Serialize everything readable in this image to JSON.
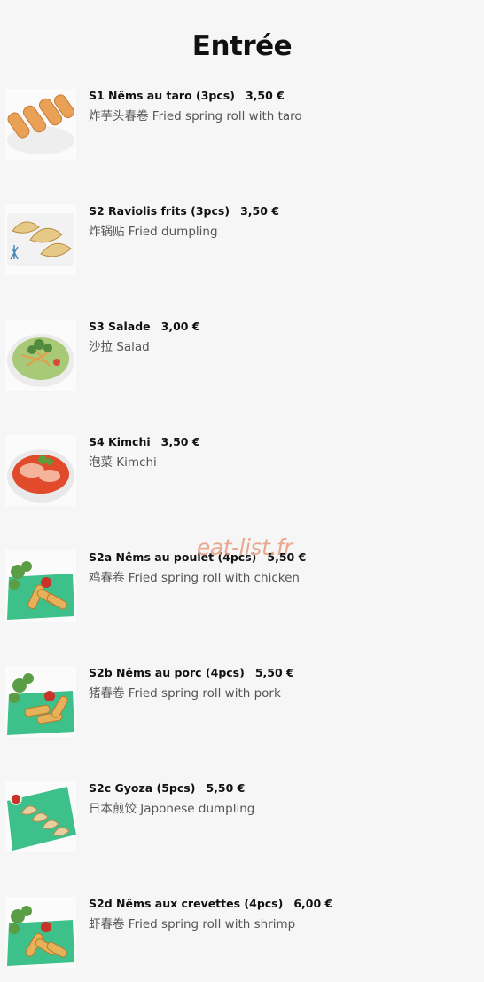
{
  "page": {
    "title": "Entrée"
  },
  "watermark": "eat-list.fr",
  "items": [
    {
      "code_name": "S1 Nêms au taro (3pcs)",
      "price": "3,50 €",
      "zh": "炸芋头春卷",
      "en": "Fried spring roll with taro",
      "image": "taro-spring-roll-photo"
    },
    {
      "code_name": "S2 Raviolis frits (3pcs)",
      "price": "3,50 €",
      "zh": "炸锅贴",
      "en": "Fried dumpling",
      "image": "fried-dumpling-photo"
    },
    {
      "code_name": "S3 Salade",
      "price": "3,00 €",
      "zh": "沙拉",
      "en": "Salad",
      "image": "salad-photo"
    },
    {
      "code_name": "S4 Kimchi",
      "price": "3,50 €",
      "zh": "泡菜",
      "en": "Kimchi",
      "image": "kimchi-photo"
    },
    {
      "code_name": "S2a Nêms au poulet (4pcs)",
      "price": "5,50 €",
      "zh": "鸡春卷",
      "en": "Fried spring roll with chicken",
      "image": "chicken-spring-roll-photo"
    },
    {
      "code_name": "S2b Nêms au porc (4pcs)",
      "price": "5,50 €",
      "zh": "猪春卷",
      "en": "Fried spring roll with pork",
      "image": "pork-spring-roll-photo"
    },
    {
      "code_name": "S2c Gyoza (5pcs)",
      "price": "5,50 €",
      "zh": "日本煎饺",
      "en": "Japonese dumpling",
      "image": "gyoza-photo"
    },
    {
      "code_name": "S2d Nêms aux crevettes (4pcs)",
      "price": "6,00 €",
      "zh": "虾春卷",
      "en": "Fried spring roll with shrimp",
      "image": "shrimp-spring-roll-photo"
    }
  ]
}
